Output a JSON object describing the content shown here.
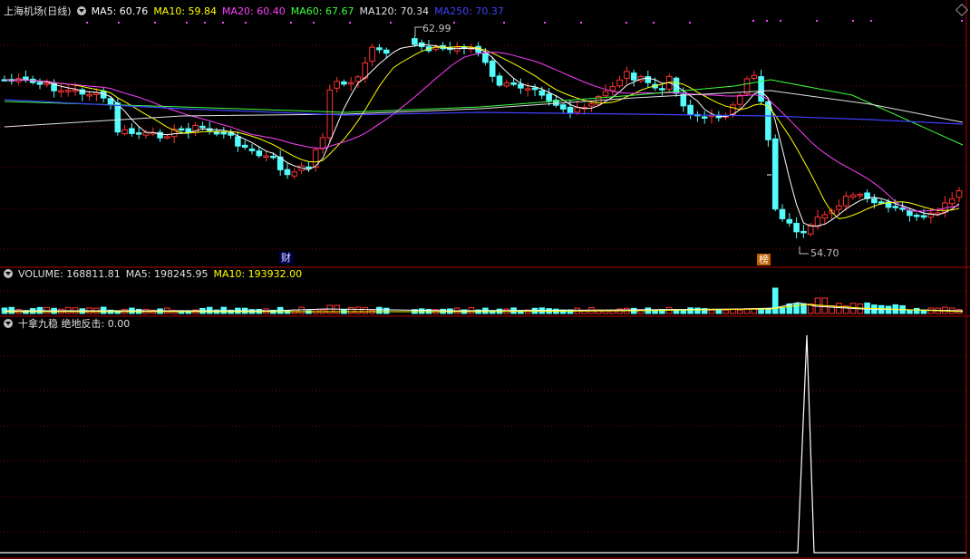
{
  "main": {
    "title": "上海机场(日线)",
    "ma": [
      {
        "label": "MA5: 60.76",
        "color": "#ffffff"
      },
      {
        "label": "MA10: 59.84",
        "color": "#ffff00"
      },
      {
        "label": "MA20: 60.40",
        "color": "#ff40ff"
      },
      {
        "label": "MA60: 67.67",
        "color": "#40ff40"
      },
      {
        "label": "MA120: 70.34",
        "color": "#e0e0e0"
      },
      {
        "label": "MA250: 70.37",
        "color": "#4040ff"
      }
    ],
    "high_label": "62.99",
    "low_label": "54.70",
    "badge_cai": "财",
    "badge_bang": "榜"
  },
  "volume": {
    "label": "VOLUME: 168811.81",
    "ma5": "MA5: 198245.95",
    "ma10": "MA10: 193932.00"
  },
  "indicator": {
    "title": "十拿九稳 绝地反击: 0.00"
  },
  "colors": {
    "up": "#ff3232",
    "down": "#54fcfc",
    "grid": "#7a0000",
    "border": "#b00000"
  }
}
